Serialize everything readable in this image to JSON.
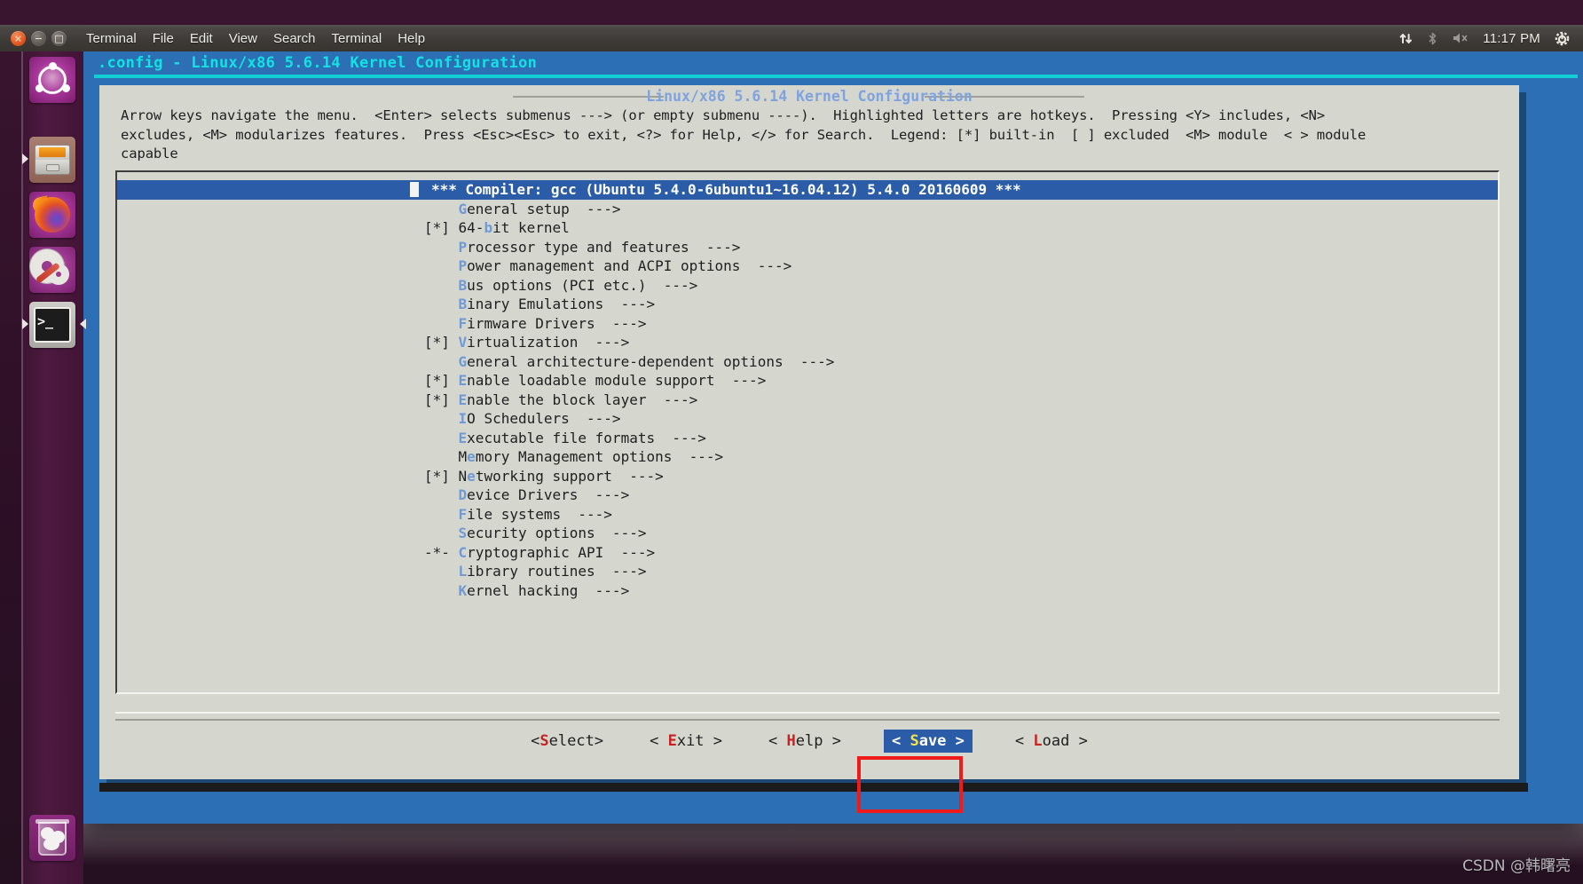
{
  "window": {
    "titlebar_menus": [
      "Terminal",
      "File",
      "Edit",
      "View",
      "Search",
      "Terminal",
      "Help"
    ],
    "close_glyph": "×",
    "minimize_glyph": "−",
    "maximize_glyph": "□",
    "terminal_title": ".config - Linux/x86 5.6.14 Kernel Configuration"
  },
  "tray": {
    "network_glyph": "⇅",
    "bluetooth_glyph": "␢",
    "volume_glyph": "🔇",
    "clock": "11:17 PM",
    "power_glyph": "⚙"
  },
  "launcher": {
    "items": [
      {
        "name": "dash-home",
        "label": "Ubuntu Dash"
      },
      {
        "name": "files",
        "label": "Files"
      },
      {
        "name": "firefox",
        "label": "Firefox"
      },
      {
        "name": "system-settings",
        "label": "System Settings"
      },
      {
        "name": "terminal",
        "label": "Terminal"
      },
      {
        "name": "trash",
        "label": "Trash"
      }
    ]
  },
  "dialog": {
    "title": "Linux/x86 5.6.14 Kernel Configuration",
    "help_text": "Arrow keys navigate the menu.  <Enter> selects submenus ---> (or empty submenu ----).  Highlighted letters are hotkeys.  Pressing <Y> includes, <N>\nexcludes, <M> modularizes features.  Press <Esc><Esc> to exit, <?> for Help, </> for Search.  Legend: [*] built-in  [ ] excluded  <M> module  < > module\ncapable"
  },
  "menu": {
    "items": [
      {
        "flag": "   ",
        "hotkey": "",
        "text": "*** Compiler: gcc (Ubuntu 5.4.0-6ubuntu1~16.04.12) 5.4.0 20160609 ***",
        "selected": true
      },
      {
        "flag": "   ",
        "hotkey": "G",
        "text": "eneral setup  --->",
        "selected": false
      },
      {
        "flag": "[*]",
        "hotkey": "",
        "prefix": "64-",
        "hotkey2": "b",
        "text": "it kernel",
        "selected": false
      },
      {
        "flag": "   ",
        "hotkey": "P",
        "text": "rocessor type and features  --->",
        "selected": false
      },
      {
        "flag": "   ",
        "hotkey": "P",
        "text": "ower management and ACPI options  --->",
        "selected": false
      },
      {
        "flag": "   ",
        "hotkey": "B",
        "text": "us options (PCI etc.)  --->",
        "selected": false
      },
      {
        "flag": "   ",
        "hotkey": "B",
        "text": "inary Emulations  --->",
        "selected": false
      },
      {
        "flag": "   ",
        "hotkey": "F",
        "text": "irmware Drivers  --->",
        "selected": false
      },
      {
        "flag": "[*]",
        "hotkey": "V",
        "text": "irtualization  --->",
        "selected": false
      },
      {
        "flag": "   ",
        "hotkey": "G",
        "text": "eneral architecture-dependent options  --->",
        "selected": false
      },
      {
        "flag": "[*]",
        "hotkey": "E",
        "text": "nable loadable module support  --->",
        "selected": false
      },
      {
        "flag": "[*]",
        "hotkey": "E",
        "text": "nable the block layer  --->",
        "selected": false
      },
      {
        "flag": "   ",
        "hotkey": "I",
        "text": "O Schedulers  --->",
        "selected": false
      },
      {
        "flag": "   ",
        "hotkey": "E",
        "text": "xecutable file formats  --->",
        "selected": false
      },
      {
        "flag": "   ",
        "hotkey": "M",
        "prefix": "M",
        "hotkey2": "e",
        "text": "mory Management options  --->",
        "selected": false
      },
      {
        "flag": "[*]",
        "hotkey": "N",
        "prefix": "N",
        "hotkey2": "e",
        "text": "tworking support  --->",
        "selected": false
      },
      {
        "flag": "   ",
        "hotkey": "D",
        "text": "evice Drivers  --->",
        "selected": false
      },
      {
        "flag": "   ",
        "hotkey": "F",
        "text": "ile systems  --->",
        "selected": false
      },
      {
        "flag": "   ",
        "hotkey": "S",
        "text": "ecurity options  --->",
        "selected": false
      },
      {
        "flag": "-*-",
        "hotkey": "C",
        "text": "ryptographic API  --->",
        "selected": false
      },
      {
        "flag": "   ",
        "hotkey": "L",
        "text": "ibrary routines  --->",
        "selected": false
      },
      {
        "flag": "   ",
        "hotkey": "K",
        "text": "ernel hacking  --->",
        "selected": false
      }
    ]
  },
  "buttons": [
    {
      "name": "select",
      "open": "<",
      "hot": "S",
      "rest": "elect",
      "close": ">",
      "active": false
    },
    {
      "name": "exit",
      "open": "< ",
      "hot": "E",
      "rest": "xit",
      "close": " >",
      "active": false
    },
    {
      "name": "help",
      "open": "< ",
      "hot": "H",
      "rest": "elp",
      "close": " >",
      "active": false
    },
    {
      "name": "save",
      "open": "< ",
      "hot": "S",
      "rest": "ave",
      "close": " >",
      "active": true
    },
    {
      "name": "load",
      "open": "< ",
      "hot": "L",
      "rest": "oad",
      "close": " >",
      "active": false
    }
  ],
  "colors": {
    "terminal_blue": "#2c6fb5",
    "title_cyan": "#12e2e2",
    "dialog_grey": "#d5d6ce",
    "selection_blue": "#2a5ca8",
    "hotkey_blue": "#6f9ad6",
    "button_hotkey_red": "#c62222",
    "active_hotkey_yellow": "#f5e14a",
    "annotation_red": "#ef1a1a"
  },
  "watermark": "CSDN @韩曙亮"
}
